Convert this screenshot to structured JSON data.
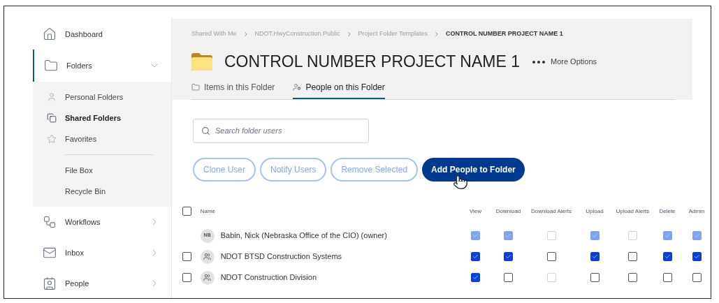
{
  "sidebar": {
    "items": [
      {
        "kind": "home",
        "label": "Dashboard",
        "selected": false
      },
      {
        "kind": "folder",
        "label": "Folders",
        "selected": true,
        "expanded": true,
        "children": [
          {
            "kind": "person",
            "label": "Personal Folders",
            "selected": false
          },
          {
            "kind": "shared",
            "label": "Shared Folders",
            "selected": true
          },
          {
            "kind": "star",
            "label": "Favorites",
            "selected": false
          },
          {
            "kind": "divider"
          },
          {
            "kind": "none",
            "label": "File Box",
            "selected": false
          },
          {
            "kind": "none",
            "label": "Recycle Bin",
            "selected": false
          }
        ]
      },
      {
        "kind": "workflow",
        "label": "Workflows",
        "selected": false,
        "expanded": false
      },
      {
        "kind": "mail",
        "label": "Inbox",
        "selected": false,
        "expanded": false
      },
      {
        "kind": "contact",
        "label": "People",
        "selected": false,
        "expanded": false
      }
    ]
  },
  "breadcrumb": [
    "Shared With Me",
    "NDOT.HwyConstruction.Public",
    "Project Folder Templates",
    "CONTROL NUMBER PROJECT NAME 1"
  ],
  "title": "CONTROL NUMBER PROJECT NAME 1",
  "more_options": "More Options",
  "tabs": [
    {
      "kind": "folder",
      "label": "Items in this Folder",
      "selected": false
    },
    {
      "kind": "people",
      "label": "People on this Folder",
      "selected": true
    }
  ],
  "search": {
    "placeholder": "Search folder users"
  },
  "buttons": [
    {
      "label": "Clone User",
      "kind": "outline"
    },
    {
      "label": "Notify Users",
      "kind": "outline"
    },
    {
      "label": "Remove Selected",
      "kind": "outline"
    },
    {
      "label": "Add People to Folder",
      "kind": "primary"
    }
  ],
  "table": {
    "select_all": {
      "checked": false
    },
    "columns": [
      "Name",
      "View",
      "Download",
      "Download Alerts",
      "Upload",
      "Upload Alerts",
      "Delete",
      "Admin"
    ],
    "rows": [
      {
        "avatar": {
          "kind": "initials",
          "text": "NB"
        },
        "name": "Babin, Nick (Nebraska Office of the CIO) (owner)",
        "selectable": false,
        "permissions": [
          {
            "checked": true,
            "disabled": true
          },
          {
            "checked": true,
            "disabled": true
          },
          {
            "checked": false,
            "disabled": true
          },
          {
            "checked": true,
            "disabled": true
          },
          {
            "checked": false,
            "disabled": true
          },
          {
            "checked": true,
            "disabled": true
          },
          {
            "checked": true,
            "disabled": true
          }
        ]
      },
      {
        "avatar": {
          "kind": "group"
        },
        "name": "NDOT BTSD Construction Systems",
        "selectable": true,
        "checked": false,
        "permissions": [
          {
            "checked": true,
            "disabled": false
          },
          {
            "checked": true,
            "disabled": false
          },
          {
            "checked": false,
            "disabled": false
          },
          {
            "checked": true,
            "disabled": false
          },
          {
            "checked": false,
            "disabled": false
          },
          {
            "checked": true,
            "disabled": false
          },
          {
            "checked": true,
            "disabled": false
          }
        ]
      },
      {
        "avatar": {
          "kind": "group"
        },
        "name": "NDOT Construction Division",
        "selectable": true,
        "checked": false,
        "permissions": [
          {
            "checked": true,
            "disabled": false
          },
          {
            "checked": false,
            "disabled": false
          },
          {
            "checked": false,
            "disabled": true
          },
          {
            "checked": false,
            "disabled": false
          },
          {
            "checked": false,
            "disabled": false
          },
          {
            "checked": false,
            "disabled": false
          },
          {
            "checked": false,
            "disabled": false
          }
        ]
      }
    ]
  }
}
